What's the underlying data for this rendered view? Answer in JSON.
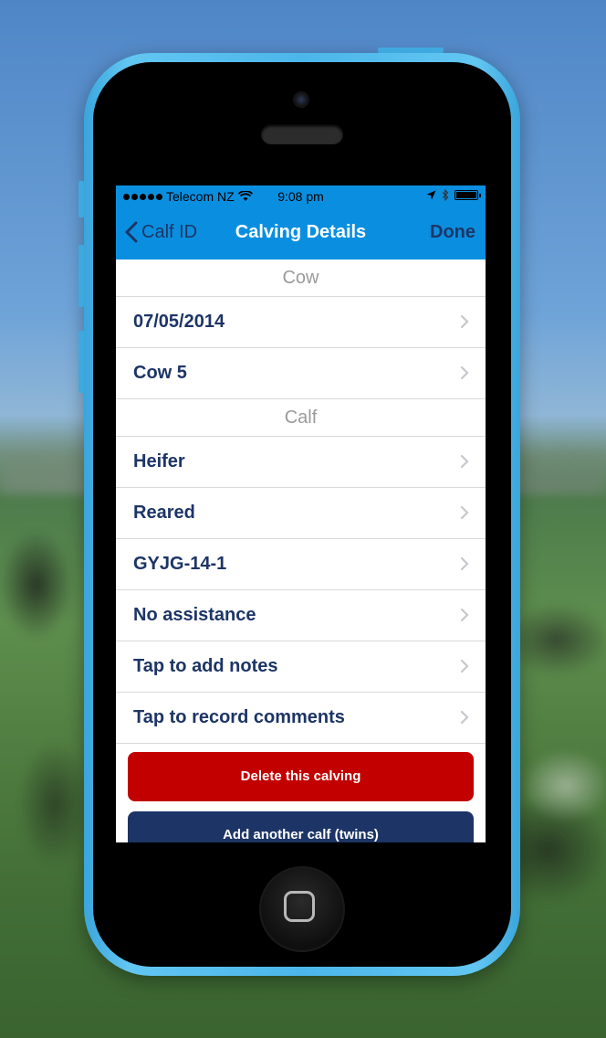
{
  "status_bar": {
    "carrier": "Telecom NZ",
    "time": "9:08 pm"
  },
  "nav": {
    "back_label": "Calf ID",
    "title": "Calving Details",
    "done_label": "Done"
  },
  "sections": {
    "cow_header": "Cow",
    "cow_rows": [
      "07/05/2014",
      "Cow 5"
    ],
    "calf_header": "Calf",
    "calf_rows": [
      "Heifer",
      "Reared",
      "GYJG-14-1",
      "No assistance",
      "Tap to add notes",
      "Tap to record comments"
    ]
  },
  "buttons": {
    "delete_label": "Delete this calving",
    "add_twin_label": "Add another calf (twins)"
  },
  "colors": {
    "nav_blue": "#0a8fe0",
    "text_navy": "#1d3566",
    "delete_red": "#c30000"
  }
}
